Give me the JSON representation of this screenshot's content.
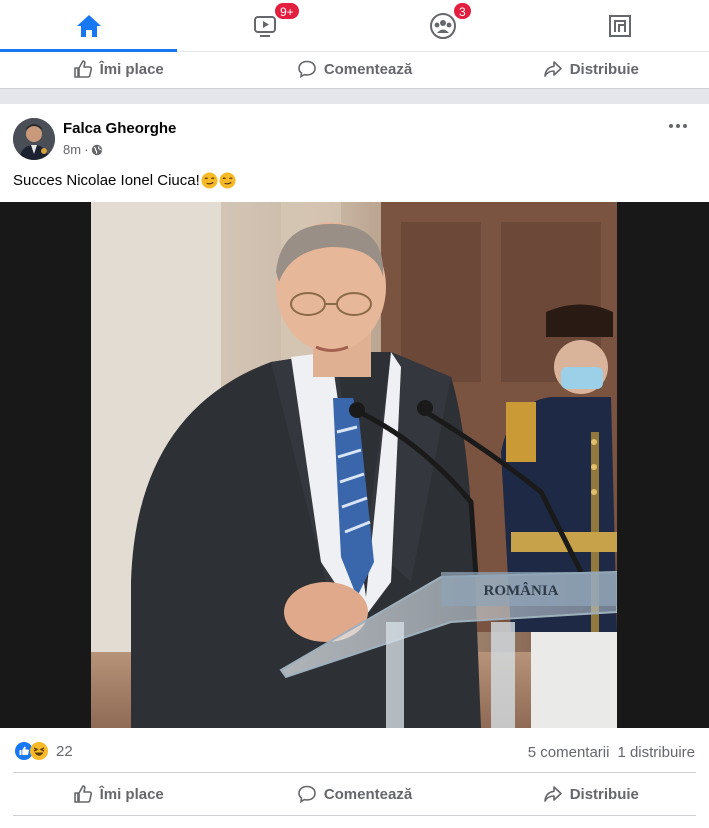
{
  "nav": {
    "tabs": [
      {
        "name": "home",
        "icon": "home-icon",
        "active": true
      },
      {
        "name": "watch",
        "icon": "watch-video-icon",
        "badge": "9+"
      },
      {
        "name": "groups",
        "icon": "groups-icon",
        "badge": "3"
      },
      {
        "name": "gaming",
        "icon": "gaming-icon"
      }
    ]
  },
  "actions": {
    "like": "Îmi place",
    "comment": "Comentează",
    "share": "Distribuie"
  },
  "post": {
    "author": "Falca Gheorghe",
    "time": "8m",
    "separator": "·",
    "privacy_icon": "globe-icon",
    "text": "Succes Nicolae Ionel Ciuca!",
    "text_emojis": [
      "smirk-face-emoji",
      "smirk-face-emoji"
    ],
    "image_podium_label": "ROMÂNIA",
    "reactions": [
      "like",
      "haha"
    ],
    "reaction_count": "22",
    "comments": "5 comentarii",
    "shares": "1 distribuire"
  },
  "colors": {
    "accent": "#1877f2",
    "badge": "#e41e3f",
    "muted_text": "#65676b",
    "haha": "#f7b928"
  }
}
